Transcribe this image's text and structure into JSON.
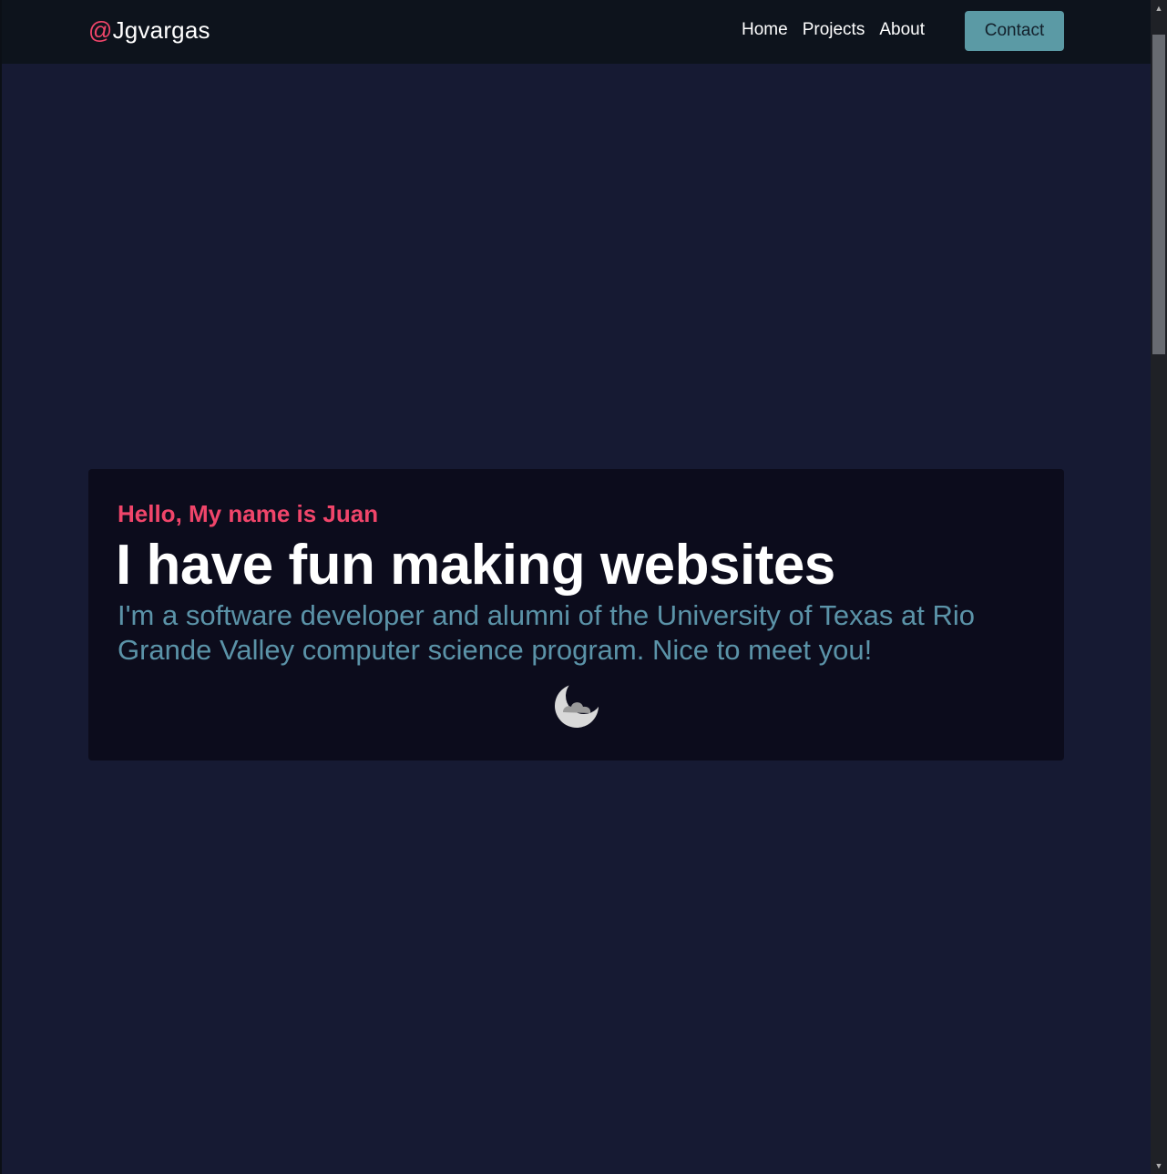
{
  "navbar": {
    "brand_at": "@",
    "brand_name": "Jgvargas",
    "links": [
      {
        "label": "Home"
      },
      {
        "label": "Projects"
      },
      {
        "label": "About"
      }
    ],
    "contact_label": "Contact"
  },
  "hero": {
    "greeting": "Hello, My name is Juan",
    "title": "I have fun making websites",
    "description": "I'm a software developer and alumni of the University of Texas at Rio Grande Valley computer science program. Nice to meet you!",
    "theme_icon": "moon-cloud-icon"
  },
  "colors": {
    "page_bg": "#161a33",
    "navbar_bg": "#0d131c",
    "card_bg": "#0c0c1c",
    "accent_pink": "#f0456a",
    "accent_teal": "#5b9aa5",
    "desc_text": "#5b93a8"
  }
}
